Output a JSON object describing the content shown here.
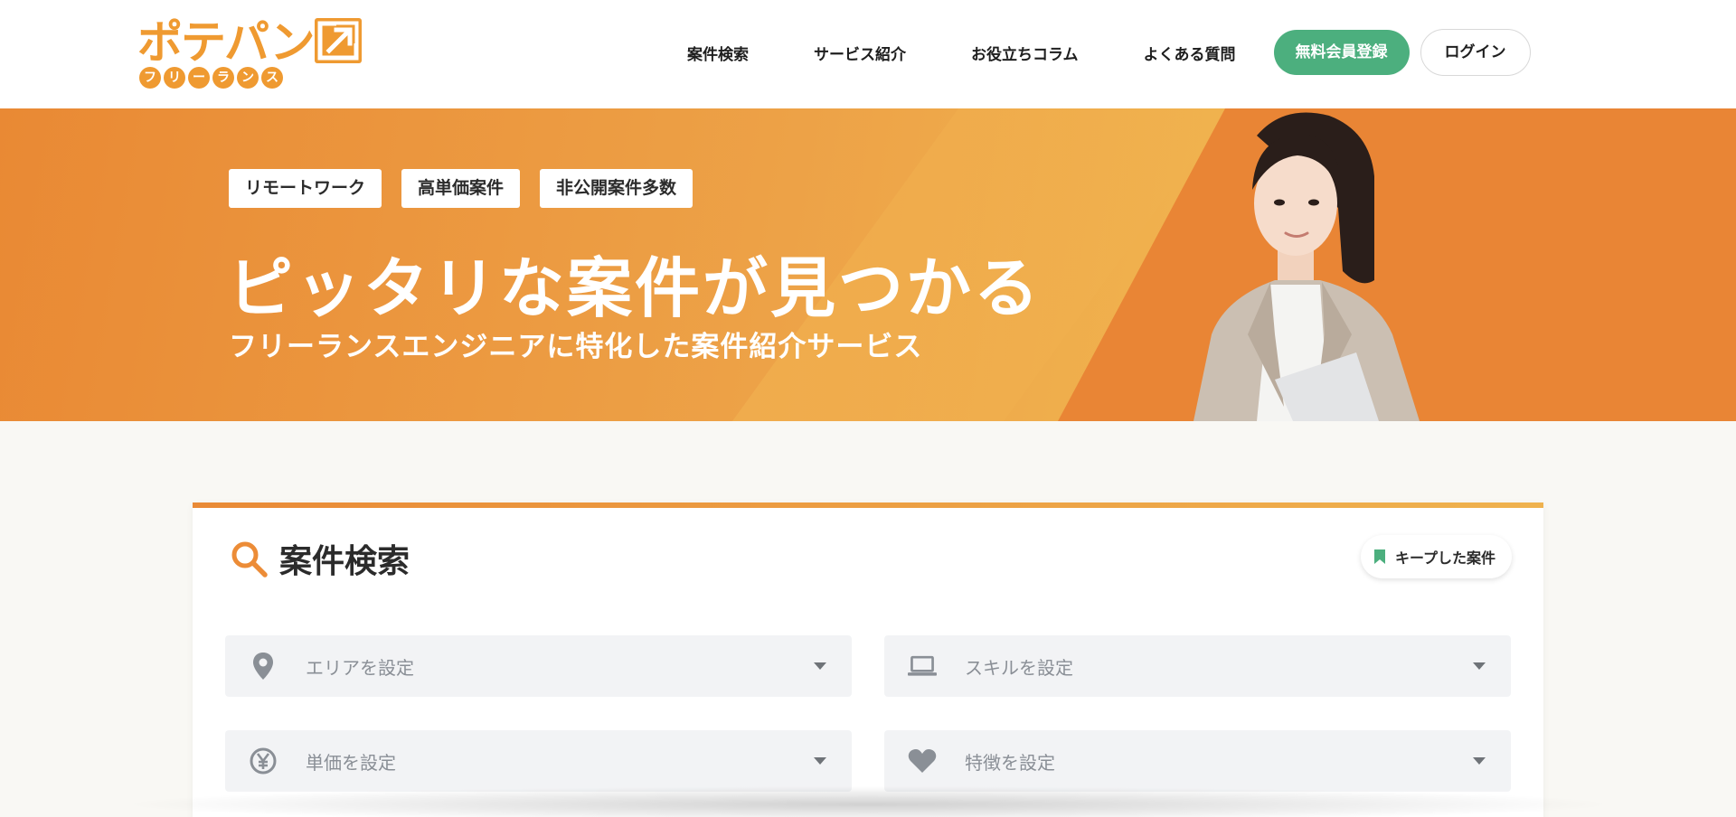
{
  "brand": {
    "logo_main": "ポテパン",
    "logo_sub_chars": [
      "フ",
      "リ",
      "ー",
      "ラ",
      "ン",
      "ス"
    ],
    "logo_sub": "フリーランス",
    "color_orange": "#ef9a31",
    "color_green": "#4caf7e"
  },
  "nav": {
    "links": [
      "案件検索",
      "サービス紹介",
      "お役立ちコラム",
      "よくある質問"
    ],
    "register_label": "無料会員登録",
    "login_label": "ログイン"
  },
  "hero": {
    "tags": [
      "リモートワーク",
      "高単価案件",
      "非公開案件多数"
    ],
    "title": "ピッタリな案件が見つかる",
    "subtitle": "フリーランスエンジニアに特化した案件紹介サービス"
  },
  "search": {
    "title": "案件検索",
    "keep_label": "キープした案件",
    "fields": [
      {
        "label": "エリアを設定",
        "icon": "location-pin-icon"
      },
      {
        "label": "スキルを設定",
        "icon": "laptop-icon"
      },
      {
        "label": "単価を設定",
        "icon": "yen-icon"
      },
      {
        "label": "特徴を設定",
        "icon": "heart-icon"
      }
    ]
  }
}
